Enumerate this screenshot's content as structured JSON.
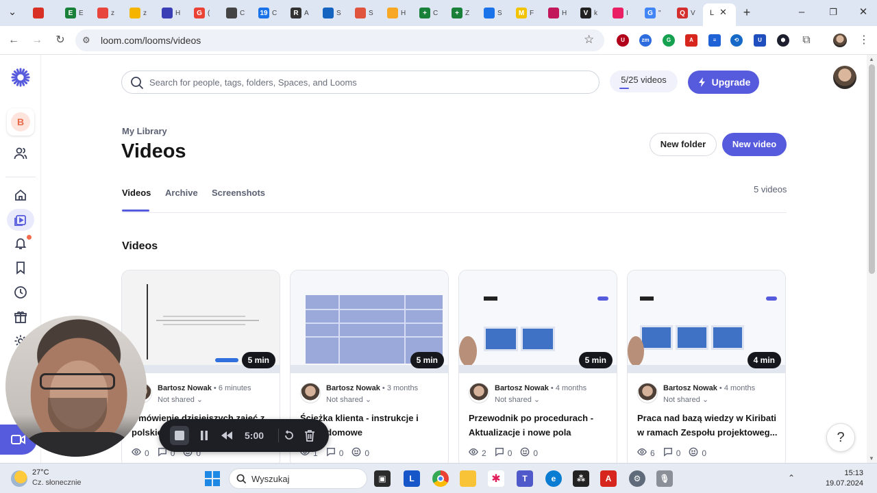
{
  "browser": {
    "tabs": [
      {
        "icon": "circle-icon",
        "letter": "",
        "color": "#d93025",
        "suffix": ""
      },
      {
        "icon": "sheet-icon",
        "letter": "E",
        "color": "#188038",
        "suffix": "E"
      },
      {
        "icon": "mask-icon",
        "letter": "",
        "color": "#e8453c",
        "suffix": "z"
      },
      {
        "icon": "note-icon",
        "letter": "",
        "color": "#f4b400",
        "suffix": "z"
      },
      {
        "icon": "shield-icon",
        "letter": "",
        "color": "#3b3fb6",
        "suffix": "H"
      },
      {
        "icon": "g-icon",
        "letter": "G",
        "color": "#ea4335",
        "suffix": "("
      },
      {
        "icon": "openai-icon",
        "letter": "",
        "color": "#444444",
        "suffix": "C"
      },
      {
        "icon": "calendar-icon",
        "letter": "19",
        "color": "#1a73e8",
        "suffix": "C"
      },
      {
        "icon": "r-icon",
        "letter": "R",
        "color": "#333333",
        "suffix": "A"
      },
      {
        "icon": "cube-icon",
        "letter": "",
        "color": "#1565c0",
        "suffix": "S"
      },
      {
        "icon": "flame-icon",
        "letter": "",
        "color": "#e0533d",
        "suffix": "S"
      },
      {
        "icon": "peacock-icon",
        "letter": "",
        "color": "#f9a825",
        "suffix": "H"
      },
      {
        "icon": "plus-icon",
        "letter": "+",
        "color": "#188038",
        "suffix": "C"
      },
      {
        "icon": "plus-icon",
        "letter": "+",
        "color": "#188038",
        "suffix": "Z"
      },
      {
        "icon": "chat-icon",
        "letter": "",
        "color": "#1a73e8",
        "suffix": "S"
      },
      {
        "icon": "m-icon",
        "letter": "M",
        "color": "#f2c400",
        "suffix": "F"
      },
      {
        "icon": "brain-icon",
        "letter": "",
        "color": "#c2185b",
        "suffix": "H"
      },
      {
        "icon": "v-icon",
        "letter": "V",
        "color": "#222222",
        "suffix": "k"
      },
      {
        "icon": "image-icon",
        "letter": "",
        "color": "#e91e63",
        "suffix": "I"
      },
      {
        "icon": "google-icon",
        "letter": "G",
        "color": "#4285f4",
        "suffix": "\""
      },
      {
        "icon": "q-icon",
        "letter": "Q",
        "color": "#d32f2f",
        "suffix": "V"
      }
    ],
    "active_tab_label": "L",
    "new_tab_label": "+",
    "url": "loom.com/looms/videos"
  },
  "header": {
    "search_placeholder": "Search for people, tags, folders, Spaces, and Looms",
    "quota_label": "5/25 videos",
    "quota_fraction": 0.2,
    "upgrade_label": "Upgrade"
  },
  "sidebar": {
    "workspace_initial": "B"
  },
  "page": {
    "breadcrumb": "My Library",
    "title": "Videos",
    "new_folder_label": "New folder",
    "new_video_label": "New video",
    "tabs": [
      "Videos",
      "Archive",
      "Screenshots"
    ],
    "video_count": "5 videos",
    "section_title": "Videos"
  },
  "videos": [
    {
      "duration": "5 min",
      "author": "Bartosz Nowak",
      "age": "6 minutes",
      "sharing": "Not shared",
      "title": "Omówienie dzisiejszych zajęć z polskiego",
      "views": "0",
      "comments": "0",
      "reactions": "0"
    },
    {
      "duration": "5 min",
      "author": "Bartosz Nowak",
      "age": "3 months",
      "sharing": "Not shared",
      "title": "Ścieżka klienta - instrukcje i praca domowe",
      "views": "1",
      "comments": "0",
      "reactions": "0"
    },
    {
      "duration": "5 min",
      "author": "Bartosz Nowak",
      "age": "4 months",
      "sharing": "Not shared",
      "title": "Przewodnik po procedurach - Aktualizacje i nowe pola",
      "views": "2",
      "comments": "0",
      "reactions": "0"
    },
    {
      "duration": "4 min",
      "author": "Bartosz Nowak",
      "age": "4 months",
      "sharing": "Not shared",
      "title": "Praca nad bazą wiedzy w Kiribati w ramach Zespołu projektoweg...",
      "views": "6",
      "comments": "0",
      "reactions": "0"
    }
  ],
  "recorder": {
    "timer": "5:00"
  },
  "help_label": "?",
  "taskbar": {
    "temperature": "27°C",
    "weather": "Cz. słonecznie",
    "search_label": "Wyszukaj",
    "time": "15:13",
    "date": "19.07.2024"
  },
  "colors": {
    "accent": "#565adc",
    "notification_dot": "#f26b4c"
  }
}
